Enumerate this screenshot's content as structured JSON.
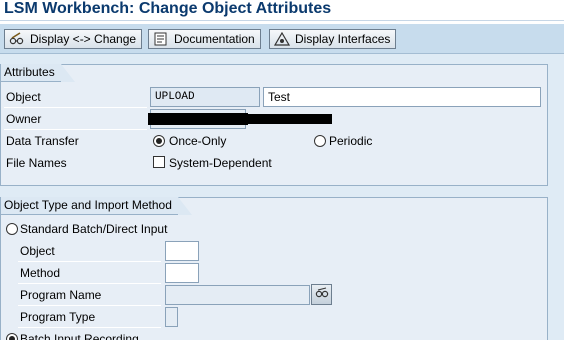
{
  "window": {
    "title": "LSM Workbench: Change Object Attributes"
  },
  "toolbar": {
    "display_change_label": "Display <-> Change",
    "documentation_label": "Documentation",
    "display_interfaces_label": "Display Interfaces"
  },
  "attributes": {
    "group_title": "Attributes",
    "object_label": "Object",
    "object_value": "UPLOAD",
    "object_description": "Test",
    "owner_label": "Owner",
    "data_transfer_label": "Data Transfer",
    "once_only_label": "Once-Only",
    "periodic_label": "Periodic",
    "data_transfer_selected": "Once-Only",
    "file_names_label": "File Names",
    "system_dependent_label": "System-Dependent",
    "system_dependent_checked": false
  },
  "import_method": {
    "group_title": "Object Type and Import Method",
    "standard_batch_label": "Standard Batch/Direct Input",
    "object_label": "Object",
    "object_value": "",
    "method_label": "Method",
    "method_value": "",
    "program_name_label": "Program Name",
    "program_name_value": "",
    "program_type_label": "Program Type",
    "program_type_value": "",
    "batch_input_recording_label": "Batch Input Recording",
    "selected": "Batch Input Recording"
  },
  "colors": {
    "title": "#0b3a6e",
    "background": "#dfebf5",
    "toolbar": "#c7dced",
    "group_border": "#98b1c8"
  }
}
